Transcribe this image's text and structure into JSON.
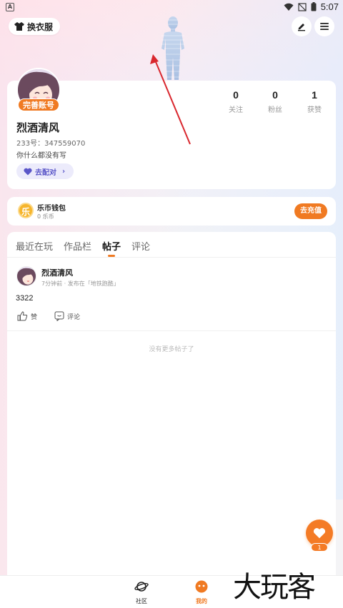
{
  "status_bar": {
    "time": "5:07",
    "app_badge": "A"
  },
  "header": {
    "outfit_button": "换衣服"
  },
  "profile": {
    "complete_badge": "完善账号",
    "username": "烈酒清风",
    "uid": "233号：347559070",
    "bio": "你什么都没有写",
    "match_button": "去配对",
    "stats": [
      {
        "value": "0",
        "label": "关注"
      },
      {
        "value": "0",
        "label": "粉丝"
      },
      {
        "value": "1",
        "label": "获赞"
      }
    ]
  },
  "wallet": {
    "icon_char": "乐",
    "title": "乐币钱包",
    "balance": "0 乐币",
    "recharge_button": "去充值"
  },
  "tabs": [
    {
      "label": "最近在玩",
      "active": false
    },
    {
      "label": "作品栏",
      "active": false
    },
    {
      "label": "帖子",
      "active": true
    },
    {
      "label": "评论",
      "active": false
    }
  ],
  "post": {
    "author": "烈酒清风",
    "meta": "7分钟前 · 发布在「地铁跑酷」",
    "body": "3322",
    "like_label": "赞",
    "comment_label": "评论"
  },
  "no_more_text": "没有更多帖子了",
  "fab_count": "1",
  "bottom_nav": [
    {
      "label": "社区",
      "icon": "planet-icon",
      "active": false
    },
    {
      "label": "我的",
      "icon": "smiley-icon",
      "active": true
    }
  ],
  "watermark": "大玩客",
  "colors": {
    "accent": "#f07a22",
    "match": "#5a56c8"
  }
}
